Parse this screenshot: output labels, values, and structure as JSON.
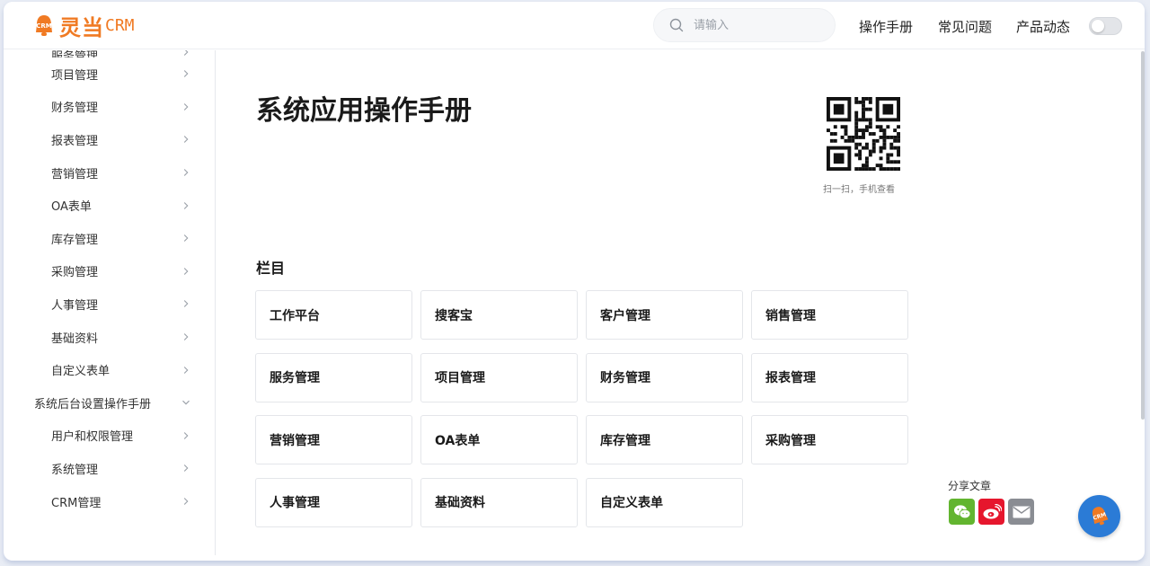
{
  "header": {
    "logo_text": "灵当",
    "logo_suffix": "CRM",
    "search_placeholder": "请输入",
    "nav": [
      "操作手册",
      "常见问题",
      "产品动态"
    ]
  },
  "sidebar": {
    "items": [
      {
        "label": "服务管理",
        "level": "sub",
        "chevron": "right"
      },
      {
        "label": "项目管理",
        "level": "sub",
        "chevron": "right"
      },
      {
        "label": "财务管理",
        "level": "sub",
        "chevron": "right"
      },
      {
        "label": "报表管理",
        "level": "sub",
        "chevron": "right"
      },
      {
        "label": "营销管理",
        "level": "sub",
        "chevron": "right"
      },
      {
        "label": "OA表单",
        "level": "sub",
        "chevron": "right"
      },
      {
        "label": "库存管理",
        "level": "sub",
        "chevron": "right"
      },
      {
        "label": "采购管理",
        "level": "sub",
        "chevron": "right"
      },
      {
        "label": "人事管理",
        "level": "sub",
        "chevron": "right"
      },
      {
        "label": "基础资料",
        "level": "sub",
        "chevron": "right"
      },
      {
        "label": "自定义表单",
        "level": "sub",
        "chevron": "right"
      },
      {
        "label": "系统后台设置操作手册",
        "level": "top",
        "chevron": "down"
      },
      {
        "label": "用户和权限管理",
        "level": "sub",
        "chevron": "right"
      },
      {
        "label": "系统管理",
        "level": "sub",
        "chevron": "right"
      },
      {
        "label": "CRM管理",
        "level": "sub",
        "chevron": "right"
      }
    ]
  },
  "main": {
    "title": "系统应用操作手册",
    "qr_caption": "扫一扫，手机查看",
    "section_title": "栏目",
    "cards": [
      "工作平台",
      "搜客宝",
      "客户管理",
      "销售管理",
      "服务管理",
      "项目管理",
      "财务管理",
      "报表管理",
      "营销管理",
      "OA表单",
      "库存管理",
      "采购管理",
      "人事管理",
      "基础资料",
      "自定义表单"
    ]
  },
  "share": {
    "label": "分享文章",
    "buttons": [
      "wechat-icon",
      "weibo-icon",
      "mail-icon"
    ]
  },
  "floating_button": {
    "icon": "crm-bell-icon",
    "text": "CRM"
  },
  "colors": {
    "brand": "#f07a23",
    "float": "#2b7bd6",
    "wechat": "#62b52f",
    "weibo": "#e6162d",
    "mail": "#8a8d93"
  }
}
